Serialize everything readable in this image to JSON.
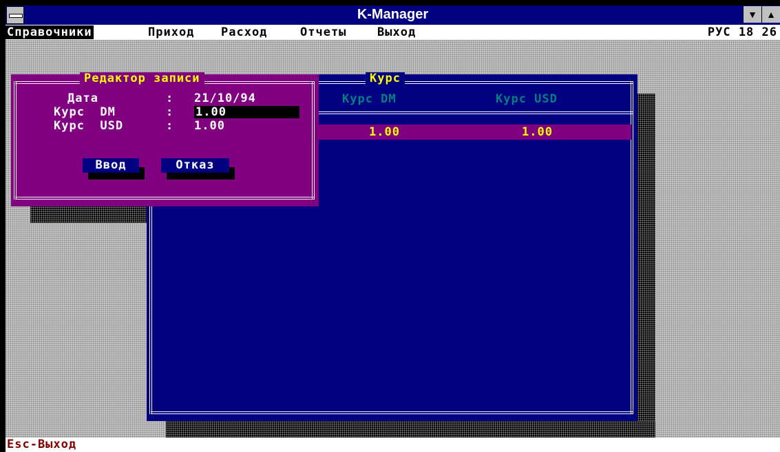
{
  "window": {
    "title": "K-Manager",
    "minimize_glyph": "▼",
    "maximize_glyph": "▲"
  },
  "menubar": {
    "items": [
      "Справочники",
      "Приход",
      "Расход",
      "Отчеты",
      "Выход"
    ],
    "status": "РУС 18 26"
  },
  "kurs_window": {
    "title": "Курс",
    "columns": [
      "Курс DM",
      "Курс USD"
    ],
    "rows": [
      {
        "dm": "1.00",
        "usd": "1.00"
      }
    ]
  },
  "editor": {
    "title": "Редактор записи",
    "fields": [
      {
        "label": "Дата",
        "sep": ":",
        "value": "21/10/94"
      },
      {
        "label": "Курс  DM",
        "sep": ":",
        "value": "1.00"
      },
      {
        "label": "Курс  USD",
        "sep": ":",
        "value": "1.00"
      }
    ],
    "buttons": {
      "ok": "Ввод",
      "cancel": "Отказ"
    }
  },
  "statusbar": {
    "text": "Esc-Выход"
  },
  "colors": {
    "desktop_bg": "#c8c8c8",
    "title_bar": "#000080",
    "kurs_window_bg": "#000080",
    "editor_bg": "#800080",
    "window_title_text": "#ffff00",
    "column_header_text": "#008080",
    "selected_row_bg": "#800080",
    "statusbar_text": "#800000"
  }
}
